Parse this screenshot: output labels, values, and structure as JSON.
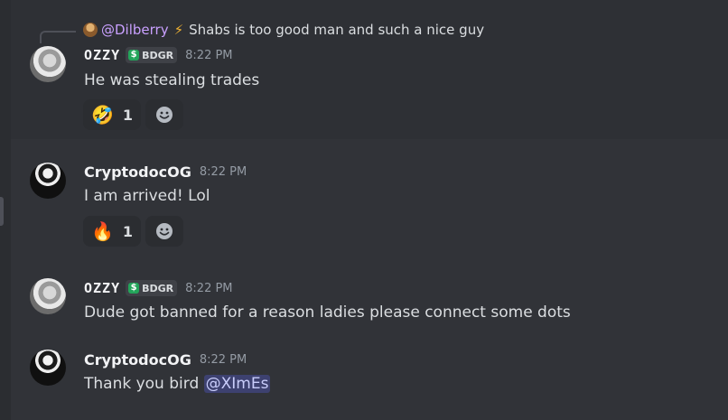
{
  "reply": {
    "mention": "@Dilberry",
    "bolt_icon": "lightning-icon",
    "text": "Shabs is too good man and such a nice guy"
  },
  "messages": [
    {
      "username": "OZZY",
      "tag": "BDGR",
      "timestamp": "8:22 PM",
      "content": "He was stealing trades",
      "reaction_emoji": "🤣",
      "reaction_count": "1"
    },
    {
      "username": "CryptodocOG",
      "timestamp": "8:22 PM",
      "content": "I am arrived! Lol",
      "reaction_emoji": "🔥",
      "reaction_count": "1"
    },
    {
      "username": "OZZY",
      "tag": "BDGR",
      "timestamp": "8:22 PM",
      "content": "Dude got banned for a reason ladies please connect some dots"
    },
    {
      "username": "CryptodocOG",
      "timestamp": "8:22 PM",
      "content_prefix": "Thank you bird ",
      "mention": "@XImEs"
    }
  ],
  "icons": {
    "add_reaction": "smile-icon",
    "tag_icon": "dollar-icon"
  },
  "colors": {
    "background": "#313338",
    "hover": "#2e3035",
    "mention_bg": "#3c4270",
    "tag_green": "#23a55a",
    "reply_mention": "#c9a0ff"
  }
}
